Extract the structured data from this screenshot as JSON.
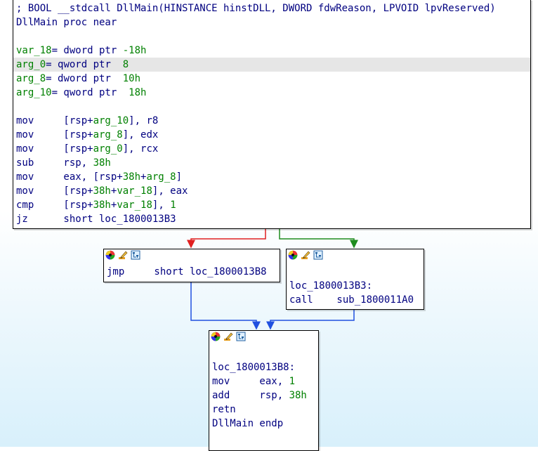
{
  "main_node": {
    "lines": [
      [
        {
          "t": "; BOOL __stdcall DllMain(HINSTANCE hinstDLL, DWORD fdwReason, LPVOID lpvReserved)",
          "c": "blue"
        }
      ],
      [
        {
          "t": "DllMain proc near",
          "c": "blue"
        }
      ],
      [],
      [
        {
          "t": "var_18",
          "c": "green"
        },
        {
          "t": "= dword ptr ",
          "c": "blue"
        },
        {
          "t": "-18h",
          "c": "green"
        }
      ],
      [
        {
          "t": "arg_0",
          "c": "green"
        },
        {
          "t": "= qword ptr  ",
          "c": "blue"
        },
        {
          "t": "8",
          "c": "green"
        }
      ],
      [
        {
          "t": "arg_8",
          "c": "green"
        },
        {
          "t": "= dword ptr  ",
          "c": "blue"
        },
        {
          "t": "10h",
          "c": "green"
        }
      ],
      [
        {
          "t": "arg_10",
          "c": "green"
        },
        {
          "t": "= qword ptr  ",
          "c": "blue"
        },
        {
          "t": "18h",
          "c": "green"
        }
      ],
      [],
      [
        {
          "t": "mov     [rsp+",
          "c": "blue"
        },
        {
          "t": "arg_10",
          "c": "green"
        },
        {
          "t": "], r8",
          "c": "blue"
        }
      ],
      [
        {
          "t": "mov     [rsp+",
          "c": "blue"
        },
        {
          "t": "arg_8",
          "c": "green"
        },
        {
          "t": "], edx",
          "c": "blue"
        }
      ],
      [
        {
          "t": "mov     [rsp+",
          "c": "blue"
        },
        {
          "t": "arg_0",
          "c": "green"
        },
        {
          "t": "], rcx",
          "c": "blue"
        }
      ],
      [
        {
          "t": "sub     rsp, ",
          "c": "blue"
        },
        {
          "t": "38h",
          "c": "green"
        }
      ],
      [
        {
          "t": "mov     eax, [rsp+",
          "c": "blue"
        },
        {
          "t": "38h",
          "c": "green"
        },
        {
          "t": "+",
          "c": "blue"
        },
        {
          "t": "arg_8",
          "c": "green"
        },
        {
          "t": "]",
          "c": "blue"
        }
      ],
      [
        {
          "t": "mov     [rsp+",
          "c": "blue"
        },
        {
          "t": "38h",
          "c": "green"
        },
        {
          "t": "+",
          "c": "blue"
        },
        {
          "t": "var_18",
          "c": "green"
        },
        {
          "t": "], eax",
          "c": "blue"
        }
      ],
      [
        {
          "t": "cmp     [rsp+",
          "c": "blue"
        },
        {
          "t": "38h",
          "c": "green"
        },
        {
          "t": "+",
          "c": "blue"
        },
        {
          "t": "var_18",
          "c": "green"
        },
        {
          "t": "], ",
          "c": "blue"
        },
        {
          "t": "1",
          "c": "green"
        }
      ],
      [
        {
          "t": "jz      short loc_1800013B3",
          "c": "blue"
        }
      ]
    ]
  },
  "left_node": {
    "lines": [
      [
        {
          "t": "jmp     short loc_1800013B8",
          "c": "blue"
        }
      ]
    ]
  },
  "right_node": {
    "lines": [
      [],
      [
        {
          "t": "loc_1800013B3:",
          "c": "blue"
        }
      ],
      [
        {
          "t": "call    sub_1800011A0",
          "c": "blue"
        }
      ]
    ]
  },
  "bottom_node": {
    "lines": [
      [],
      [
        {
          "t": "loc_1800013B8:",
          "c": "blue"
        }
      ],
      [
        {
          "t": "mov     eax, ",
          "c": "blue"
        },
        {
          "t": "1",
          "c": "green"
        }
      ],
      [
        {
          "t": "add     rsp, ",
          "c": "blue"
        },
        {
          "t": "38h",
          "c": "green"
        }
      ],
      [
        {
          "t": "retn",
          "c": "blue"
        }
      ],
      [
        {
          "t": "DllMain endp",
          "c": "blue"
        }
      ]
    ]
  },
  "colors": {
    "edge_false": "#e02020",
    "edge_true": "#1e8c1e",
    "edge_unconditional": "#2050e0"
  },
  "icons": [
    "color-palette-icon",
    "rename-pencil-icon",
    "graph-overview-icon"
  ]
}
